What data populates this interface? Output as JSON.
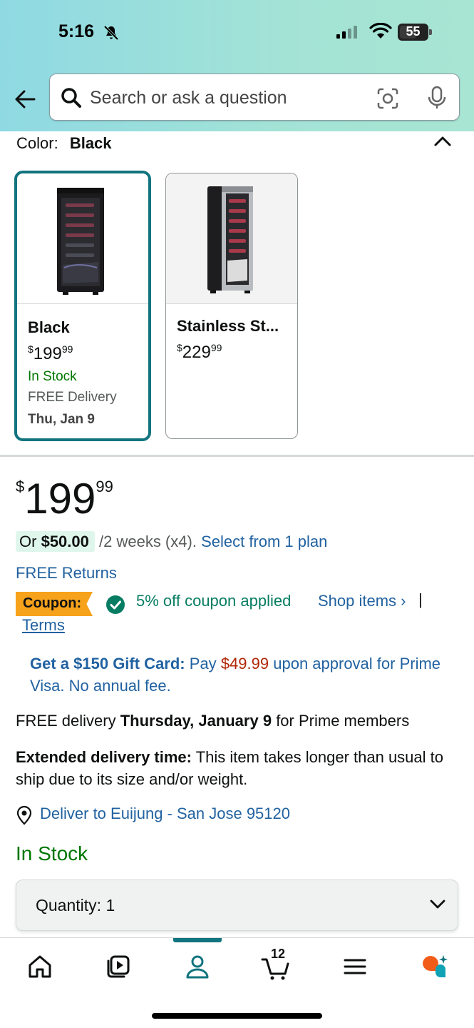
{
  "status_bar": {
    "time": "5:16",
    "battery": "55"
  },
  "search": {
    "placeholder": "Search or ask a question"
  },
  "color_section": {
    "label": "Color:",
    "selected": "Black",
    "options": [
      {
        "name": "Black",
        "price_whole": "199",
        "price_frac": "99",
        "currency": "$",
        "stock": "In Stock",
        "delivery": "FREE Delivery",
        "date": "Thu, Jan 9"
      },
      {
        "name": "Stainless St...",
        "price_whole": "229",
        "price_frac": "99",
        "currency": "$"
      }
    ]
  },
  "price": {
    "currency": "$",
    "whole": "199",
    "frac": "99"
  },
  "installments": {
    "prefix": "Or",
    "amount": "$50.00",
    "period": "/2 weeks (x4).",
    "link": "Select from 1 plan"
  },
  "returns": "FREE Returns",
  "coupon": {
    "tag": "Coupon:",
    "text": "5% off coupon applied",
    "shop_items": "Shop items ›",
    "separator": "|",
    "terms": "Terms"
  },
  "gift_card": {
    "bold": "Get a $150 Gift Card:",
    "pay": "Pay",
    "amount": "$49.99",
    "rest": "upon approval for Prime Visa. No annual fee."
  },
  "delivery": {
    "prefix": "FREE delivery",
    "date": "Thursday, January 9",
    "suffix": "for Prime members"
  },
  "extended": {
    "bold": "Extended delivery time:",
    "text": "This item takes longer than usual to ship due to its size and/or weight."
  },
  "deliver_to": "Deliver to Euijung - San Jose 95120",
  "availability": "In Stock",
  "quantity": {
    "label": "Quantity:",
    "value": "1"
  },
  "bottom_nav": {
    "cart_count": "12"
  },
  "colors": {
    "header_gradient_start": "#8fd9e3",
    "header_gradient_end": "#a8e5d2",
    "selected_border": "#11747f",
    "link": "#2162a1",
    "in_stock": "#007600",
    "coupon_tag": "#f7a21b",
    "coupon_text": "#067d62",
    "price_red": "#b12704"
  }
}
